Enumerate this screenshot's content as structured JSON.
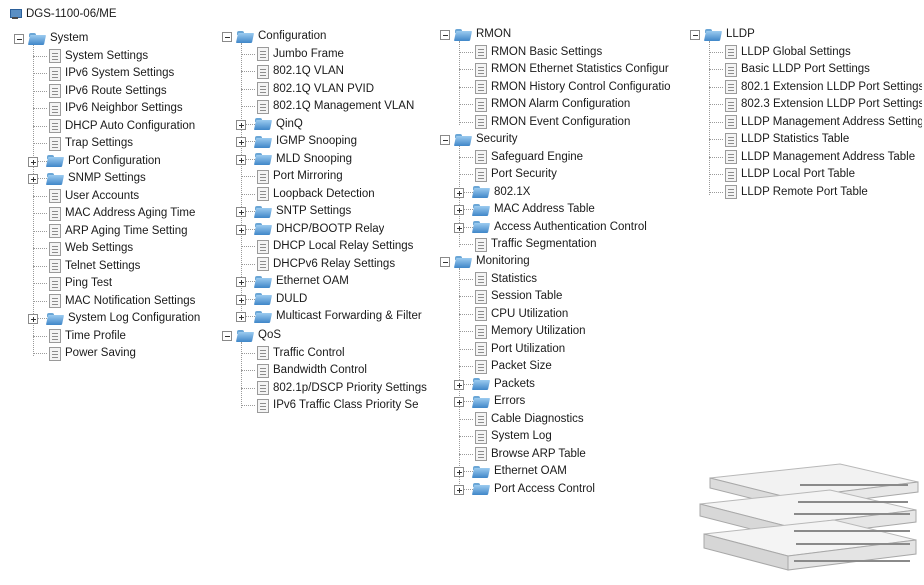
{
  "root": {
    "label": "DGS-1100-06/ME",
    "icon": "network-device-icon"
  },
  "trees": [
    {
      "label": "System",
      "expanded": true,
      "children": [
        {
          "label": "System Settings",
          "type": "page"
        },
        {
          "label": "IPv6 System Settings",
          "type": "page"
        },
        {
          "label": "IPv6 Route Settings",
          "type": "page"
        },
        {
          "label": "IPv6 Neighbor Settings",
          "type": "page"
        },
        {
          "label": "DHCP Auto Configuration",
          "type": "page"
        },
        {
          "label": "Trap Settings",
          "type": "page"
        },
        {
          "label": "Port Configuration",
          "type": "folder"
        },
        {
          "label": "SNMP Settings",
          "type": "folder"
        },
        {
          "label": "User Accounts",
          "type": "page"
        },
        {
          "label": "MAC Address Aging Time",
          "type": "page"
        },
        {
          "label": "ARP Aging Time Setting",
          "type": "page"
        },
        {
          "label": "Web Settings",
          "type": "page"
        },
        {
          "label": "Telnet Settings",
          "type": "page"
        },
        {
          "label": "Ping Test",
          "type": "page"
        },
        {
          "label": "MAC Notification Settings",
          "type": "page"
        },
        {
          "label": "System Log Configuration",
          "type": "folder"
        },
        {
          "label": "Time Profile",
          "type": "page"
        },
        {
          "label": "Power Saving",
          "type": "page"
        }
      ]
    },
    {
      "label": "Configuration",
      "expanded": true,
      "children": [
        {
          "label": "Jumbo Frame",
          "type": "page"
        },
        {
          "label": "802.1Q VLAN",
          "type": "page"
        },
        {
          "label": "802.1Q VLAN PVID",
          "type": "page"
        },
        {
          "label": "802.1Q Management VLAN",
          "type": "page"
        },
        {
          "label": "QinQ",
          "type": "folder"
        },
        {
          "label": "IGMP Snooping",
          "type": "folder"
        },
        {
          "label": "MLD Snooping",
          "type": "folder"
        },
        {
          "label": "Port Mirroring",
          "type": "page"
        },
        {
          "label": "Loopback Detection",
          "type": "page"
        },
        {
          "label": "SNTP Settings",
          "type": "folder"
        },
        {
          "label": "DHCP/BOOTP Relay",
          "type": "folder"
        },
        {
          "label": "DHCP Local Relay Settings",
          "type": "page"
        },
        {
          "label": "DHCPv6 Relay Settings",
          "type": "page"
        },
        {
          "label": "Ethernet OAM",
          "type": "folder"
        },
        {
          "label": "DULD",
          "type": "folder"
        },
        {
          "label": "Multicast Forwarding & Filter",
          "type": "folder"
        }
      ]
    },
    {
      "label": "QoS",
      "expanded": true,
      "children": [
        {
          "label": "Traffic Control",
          "type": "page"
        },
        {
          "label": "Bandwidth Control",
          "type": "page"
        },
        {
          "label": "802.1p/DSCP Priority Settings",
          "type": "page"
        },
        {
          "label": "IPv6 Traffic Class Priority Se",
          "type": "page"
        }
      ]
    },
    {
      "label": "RMON",
      "expanded": true,
      "children": [
        {
          "label": "RMON Basic Settings",
          "type": "page"
        },
        {
          "label": "RMON Ethernet Statistics Configur",
          "type": "page"
        },
        {
          "label": "RMON History Control Configuratio",
          "type": "page"
        },
        {
          "label": "RMON Alarm Configuration",
          "type": "page"
        },
        {
          "label": "RMON Event Configuration",
          "type": "page"
        }
      ]
    },
    {
      "label": "Security",
      "expanded": true,
      "children": [
        {
          "label": "Safeguard Engine",
          "type": "page"
        },
        {
          "label": "Port Security",
          "type": "page"
        },
        {
          "label": "802.1X",
          "type": "folder"
        },
        {
          "label": "MAC Address Table",
          "type": "folder"
        },
        {
          "label": "Access Authentication Control",
          "type": "folder"
        },
        {
          "label": "Traffic Segmentation",
          "type": "page"
        }
      ]
    },
    {
      "label": "Monitoring",
      "expanded": true,
      "children": [
        {
          "label": "Statistics",
          "type": "page"
        },
        {
          "label": "Session Table",
          "type": "page"
        },
        {
          "label": "CPU Utilization",
          "type": "page"
        },
        {
          "label": "Memory Utilization",
          "type": "page"
        },
        {
          "label": "Port Utilization",
          "type": "page"
        },
        {
          "label": "Packet Size",
          "type": "page"
        },
        {
          "label": "Packets",
          "type": "folder"
        },
        {
          "label": "Errors",
          "type": "folder"
        },
        {
          "label": "Cable Diagnostics",
          "type": "page"
        },
        {
          "label": "System Log",
          "type": "page"
        },
        {
          "label": "Browse ARP Table",
          "type": "page"
        },
        {
          "label": "Ethernet OAM",
          "type": "folder"
        },
        {
          "label": "Port Access Control",
          "type": "folder"
        }
      ]
    },
    {
      "label": "LLDP",
      "expanded": true,
      "children": [
        {
          "label": "LLDP Global Settings",
          "type": "page"
        },
        {
          "label": "Basic LLDP Port Settings",
          "type": "page"
        },
        {
          "label": "802.1 Extension LLDP Port Settings",
          "type": "page"
        },
        {
          "label": "802.3 Extension LLDP Port Settings",
          "type": "page"
        },
        {
          "label": "LLDP Management Address Settings",
          "type": "page"
        },
        {
          "label": "LLDP Statistics Table",
          "type": "page"
        },
        {
          "label": "LLDP Management Address Table",
          "type": "page"
        },
        {
          "label": "LLDP Local Port Table",
          "type": "page"
        },
        {
          "label": "LLDP Remote Port Table",
          "type": "page"
        }
      ]
    }
  ],
  "product_image": {
    "icon": "switch-stack-image"
  }
}
